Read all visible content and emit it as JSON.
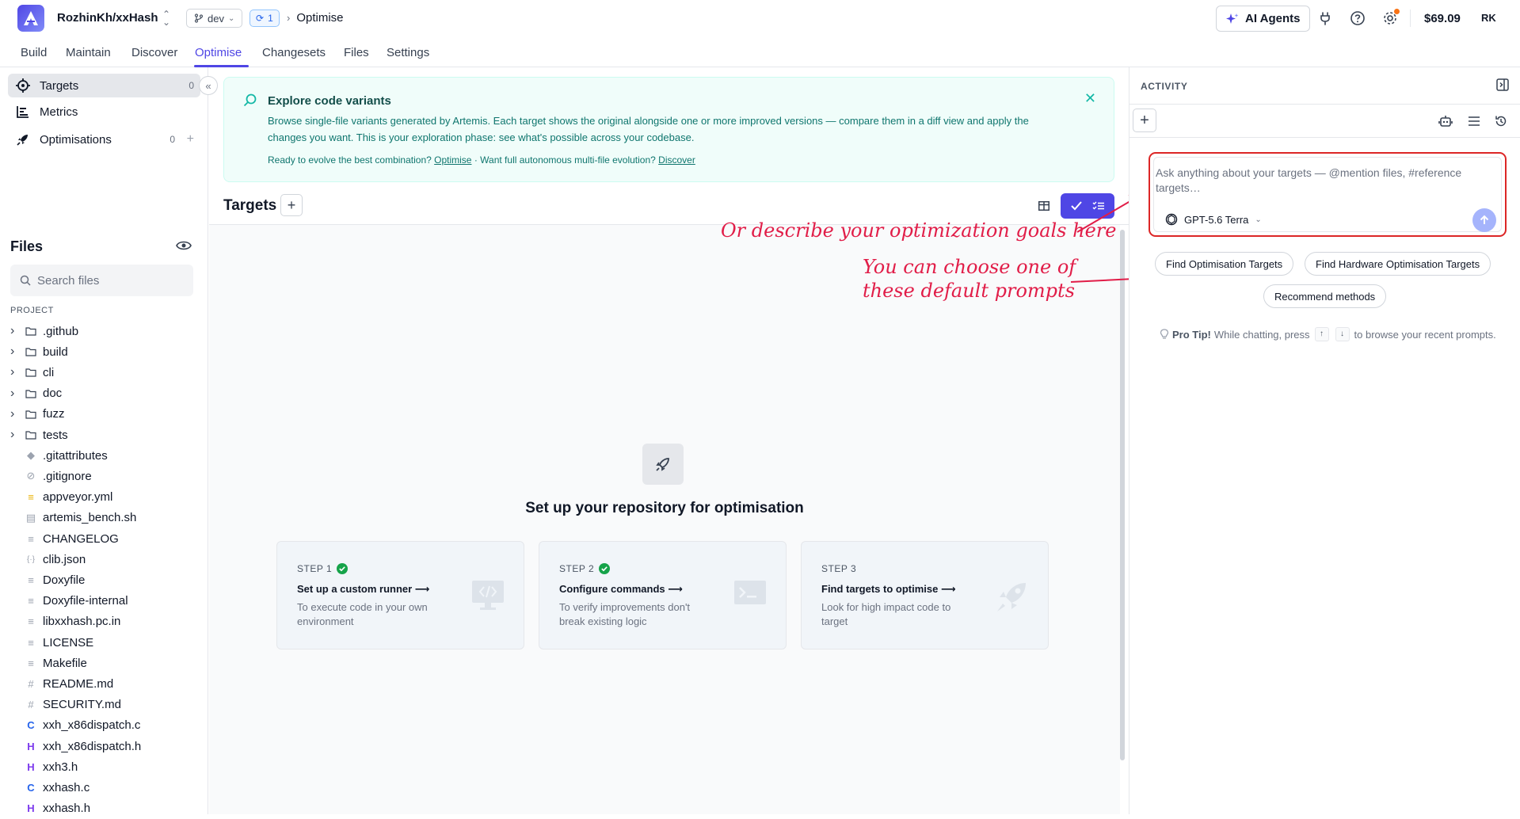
{
  "header": {
    "repo": "RozhinKh/xxHash",
    "branch": "dev",
    "sync_count": "1",
    "breadcrumb": "Optimise",
    "ai_agents_label": "AI Agents",
    "credit": "$69.09",
    "avatar_initials": "RK"
  },
  "nav": {
    "tabs": [
      "Build",
      "Maintain",
      "Discover",
      "Optimise",
      "Changesets",
      "Files",
      "Settings"
    ],
    "active": "Optimise"
  },
  "sidebar": {
    "items": [
      {
        "label": "Targets",
        "count": "0"
      },
      {
        "label": "Metrics",
        "count": ""
      },
      {
        "label": "Optimisations",
        "count": "0"
      }
    ],
    "files_title": "Files",
    "search_placeholder": "Search files",
    "project_label": "PROJECT",
    "tree": [
      {
        "name": ".github",
        "type": "folder"
      },
      {
        "name": "build",
        "type": "folder"
      },
      {
        "name": "cli",
        "type": "folder"
      },
      {
        "name": "doc",
        "type": "folder"
      },
      {
        "name": "fuzz",
        "type": "folder"
      },
      {
        "name": "tests",
        "type": "folder"
      },
      {
        "name": ".gitattributes",
        "type": "git"
      },
      {
        "name": ".gitignore",
        "type": "ignore"
      },
      {
        "name": "appveyor.yml",
        "type": "yaml"
      },
      {
        "name": "artemis_bench.sh",
        "type": "shell"
      },
      {
        "name": "CHANGELOG",
        "type": "text"
      },
      {
        "name": "clib.json",
        "type": "json"
      },
      {
        "name": "Doxyfile",
        "type": "text"
      },
      {
        "name": "Doxyfile-internal",
        "type": "text"
      },
      {
        "name": "libxxhash.pc.in",
        "type": "text"
      },
      {
        "name": "LICENSE",
        "type": "text"
      },
      {
        "name": "Makefile",
        "type": "text"
      },
      {
        "name": "README.md",
        "type": "markdown"
      },
      {
        "name": "SECURITY.md",
        "type": "markdown"
      },
      {
        "name": "xxh_x86dispatch.c",
        "type": "c"
      },
      {
        "name": "xxh_x86dispatch.h",
        "type": "h"
      },
      {
        "name": "xxh3.h",
        "type": "h"
      },
      {
        "name": "xxhash.c",
        "type": "c"
      },
      {
        "name": "xxhash.h",
        "type": "h"
      }
    ]
  },
  "banner": {
    "title": "Explore code variants",
    "text": "Browse single-file variants generated by Artemis. Each target shows the original alongside one or more improved versions — compare them in a diff view and apply the changes you want. This is your exploration phase: see what's possible across your codebase.",
    "ready_text": "Ready to evolve the best combination?",
    "optimise_link": "Optimise",
    "middle_text": "· Want full autonomous multi-file evolution?",
    "discover_link": "Discover"
  },
  "main": {
    "targets_title": "Targets",
    "setup_title": "Set up your repository for optimisation",
    "steps": [
      {
        "label": "STEP 1",
        "heading": "Set up a custom runner ⟶",
        "desc": "To execute code in your own environment",
        "done": true
      },
      {
        "label": "STEP 2",
        "heading": "Configure commands ⟶",
        "desc": "To verify improvements don't break existing logic",
        "done": true
      },
      {
        "label": "STEP 3",
        "heading": "Find targets to optimise ⟶",
        "desc": "Look for high impact code to target",
        "done": false
      }
    ]
  },
  "annotations": {
    "goals": "Or describe your optimization goals here",
    "prompts_line1": "You can choose one of",
    "prompts_line2": "these default prompts",
    "color": "#e11d48"
  },
  "activity": {
    "title": "ACTIVITY",
    "chat_placeholder": "Ask anything about your targets — @mention files, #reference targets…",
    "model": "GPT-5.6 Terra",
    "prompts": [
      "Find Optimisation Targets",
      "Find Hardware Optimisation Targets",
      "Recommend methods"
    ],
    "tip_label": "Pro Tip!",
    "tip_text": "While chatting, press",
    "tip_key_up": "↑",
    "tip_key_down": "↓",
    "tip_end": "to browse your recent prompts."
  },
  "colors": {
    "accent": "#4f46e5",
    "banner_bg": "#f0fdfa",
    "annotation": "#e11d48",
    "step_check": "#16a34a"
  }
}
